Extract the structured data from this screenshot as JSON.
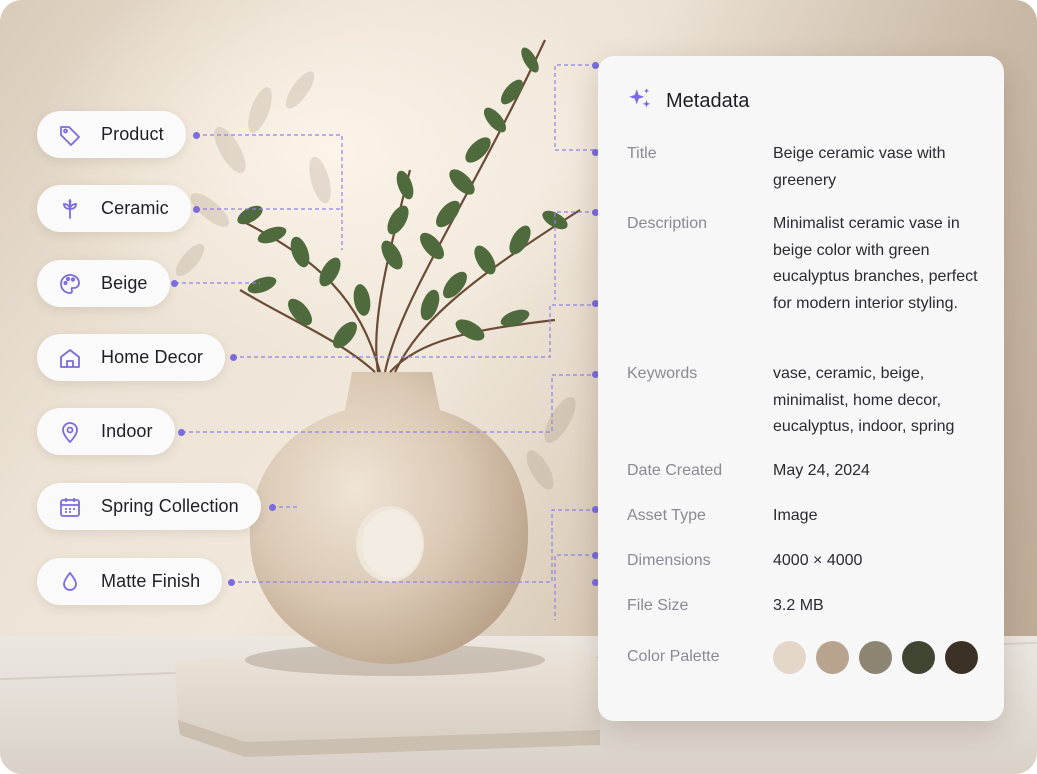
{
  "tags": [
    {
      "label": "Product",
      "icon": "tag-icon"
    },
    {
      "label": "Ceramic",
      "icon": "sprout-icon"
    },
    {
      "label": "Beige",
      "icon": "palette-icon"
    },
    {
      "label": "Home Decor",
      "icon": "home-icon"
    },
    {
      "label": "Indoor",
      "icon": "location-pin-icon"
    },
    {
      "label": "Spring Collection",
      "icon": "calendar-icon"
    },
    {
      "label": "Matte Finish",
      "icon": "droplet-icon"
    }
  ],
  "metadata": {
    "title": "Metadata",
    "icon": "sparkles-icon",
    "fields": {
      "title_key": "Title",
      "title_value": "Beige ceramic vase with greenery",
      "description_key": "Description",
      "description_value": "Minimalist ceramic vase in beige color with green eucalyptus branches, perfect for modern interior styling.",
      "keywords_key": "Keywords",
      "keywords_value": "vase, ceramic, beige, minimalist, home decor, eucalyptus, indoor, spring",
      "date_key": "Date Created",
      "date_value": "May 24, 2024",
      "asset_type_key": "Asset Type",
      "asset_type_value": "Image",
      "dimensions_key": "Dimensions",
      "dimensions_value": "4000 × 4000",
      "file_size_key": "File Size",
      "file_size_value": "3.2 MB",
      "palette_key": "Color Palette"
    },
    "color_palette": [
      "#e4d6c8",
      "#b8a38f",
      "#8b8572",
      "#3e4632",
      "#3c3127"
    ]
  },
  "colors": {
    "accent": "#7a6be0",
    "connector": "#8f82e6"
  }
}
